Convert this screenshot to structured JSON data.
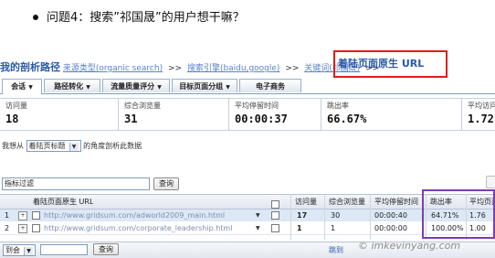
{
  "question": "问题4：搜索”祁国晟”的用户想干嘛？",
  "breadcrumb": {
    "title": "我的剖析路径",
    "items": [
      "来源类型(organic search)",
      "搜索引擎(baidu,google)",
      "关键词(祁国晟)"
    ],
    "separator": ">>",
    "current": "着陆页面原生 URL"
  },
  "tabs": [
    {
      "label": "会话",
      "has_dropdown": true
    },
    {
      "label": "路径转化",
      "has_dropdown": true
    },
    {
      "label": "流量质量评分",
      "has_dropdown": true
    },
    {
      "label": "目标页面分组",
      "has_dropdown": true
    },
    {
      "label": "电子商务",
      "has_dropdown": false
    }
  ],
  "metrics": [
    {
      "label": "访问量",
      "value": "18"
    },
    {
      "label": "综合浏览量",
      "value": "31"
    },
    {
      "label": "平均停留时间",
      "value": "00:00:37"
    },
    {
      "label": "跳出率",
      "value": "66.67%"
    },
    {
      "label": "平均访问",
      "value": "1.72"
    }
  ],
  "dimension": {
    "prefix": "我想从",
    "selected": "着陆页标题",
    "suffix": "的角度剖析此数据"
  },
  "filter": {
    "placeholder": "指标过滤",
    "query_label": "查询"
  },
  "table": {
    "columns": [
      "着陆页面原生 URL",
      "访问量",
      "综合浏览量",
      "平均停留时间",
      "跳出率",
      "平均页面"
    ],
    "rows": [
      {
        "index": "1",
        "url": "http://www.gridsum.com/adworld2009_main.html",
        "visits": "17",
        "pageviews": "30",
        "avg_time": "00:00:40",
        "bounce": "64.71%",
        "avg_pages": "1.76"
      },
      {
        "index": "2",
        "url": "http://www.gridsum.com/corporate_leadership.html",
        "visits": "1",
        "pageviews": "1",
        "avg_time": "00:00:00",
        "bounce": "100.00%",
        "avg_pages": "1.00"
      }
    ]
  },
  "pager": {
    "select_label": "到会",
    "button_label": "查询",
    "jump_label": "跳到"
  },
  "watermark": "© imkevinyang.com",
  "colors": {
    "highlight_box": "#e21b1b",
    "bounce_box": "#7a3fb5",
    "link_blue": "#2b5aa8"
  }
}
